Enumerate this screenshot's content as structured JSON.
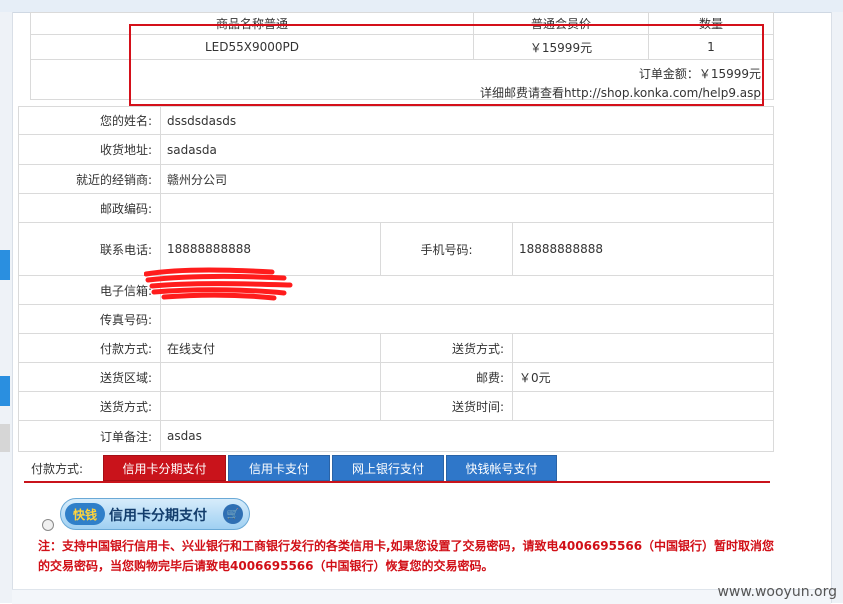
{
  "order": {
    "headers": [
      "商品名称普通",
      "普通会员价",
      "数量"
    ],
    "item": {
      "name": "LED55X9000PD",
      "price": "￥15999元",
      "qty": "1"
    },
    "total": "订单金额：￥15999元",
    "shipping_info": "详细邮费请查看http://shop.konka.com/help9.asp"
  },
  "customer": {
    "name_label": "您的姓名:",
    "name": "dssdsdasds",
    "address_label": "收货地址:",
    "address": "sadasda",
    "dealer_label": "就近的经销商:",
    "dealer": "赣州分公司",
    "postcode_label": "邮政编码:",
    "postcode": "",
    "phone_label": "联系电话:",
    "phone": "18888888888",
    "mobile_label": "手机号码:",
    "mobile": "18888888888",
    "email_label": "电子信箱:",
    "fax_label": "传真号码:",
    "fax": "",
    "pay_method_label": "付款方式:",
    "pay_method": "在线支付",
    "ship_method_label": "送货方式:",
    "ship_method": "",
    "area_label": "送货区域:",
    "area": "",
    "postage_label": "邮费:",
    "postage": "￥0元",
    "ship_method2_label": "送货方式:",
    "ship_method2": "",
    "ship_time_label": "送货时间:",
    "ship_time": "",
    "remark_label": "订单备注:",
    "remark": "asdas"
  },
  "payment": {
    "label": "付款方式:",
    "tabs": [
      "信用卡分期支付",
      "信用卡支付",
      "网上银行支付",
      "快钱帐号支付"
    ],
    "active_tab": 0,
    "logo_text": "快钱",
    "installment_button": "信用卡分期支付",
    "note": "注：支持中国银行信用卡、兴业银行和工商银行发行的各类信用卡,如果您设置了交易密码，请致电4006695566（中国银行）暂时取消您的交易密码，当您购物完毕后请致电4006695566（中国银行）恢复您的交易密码。"
  },
  "colors": {
    "accent_red": "#c9131b",
    "tab_blue": "#2f77c9",
    "note_red": "#d10f17",
    "highlight_red": "#d4101a"
  },
  "watermark": "www.wooyun.org"
}
